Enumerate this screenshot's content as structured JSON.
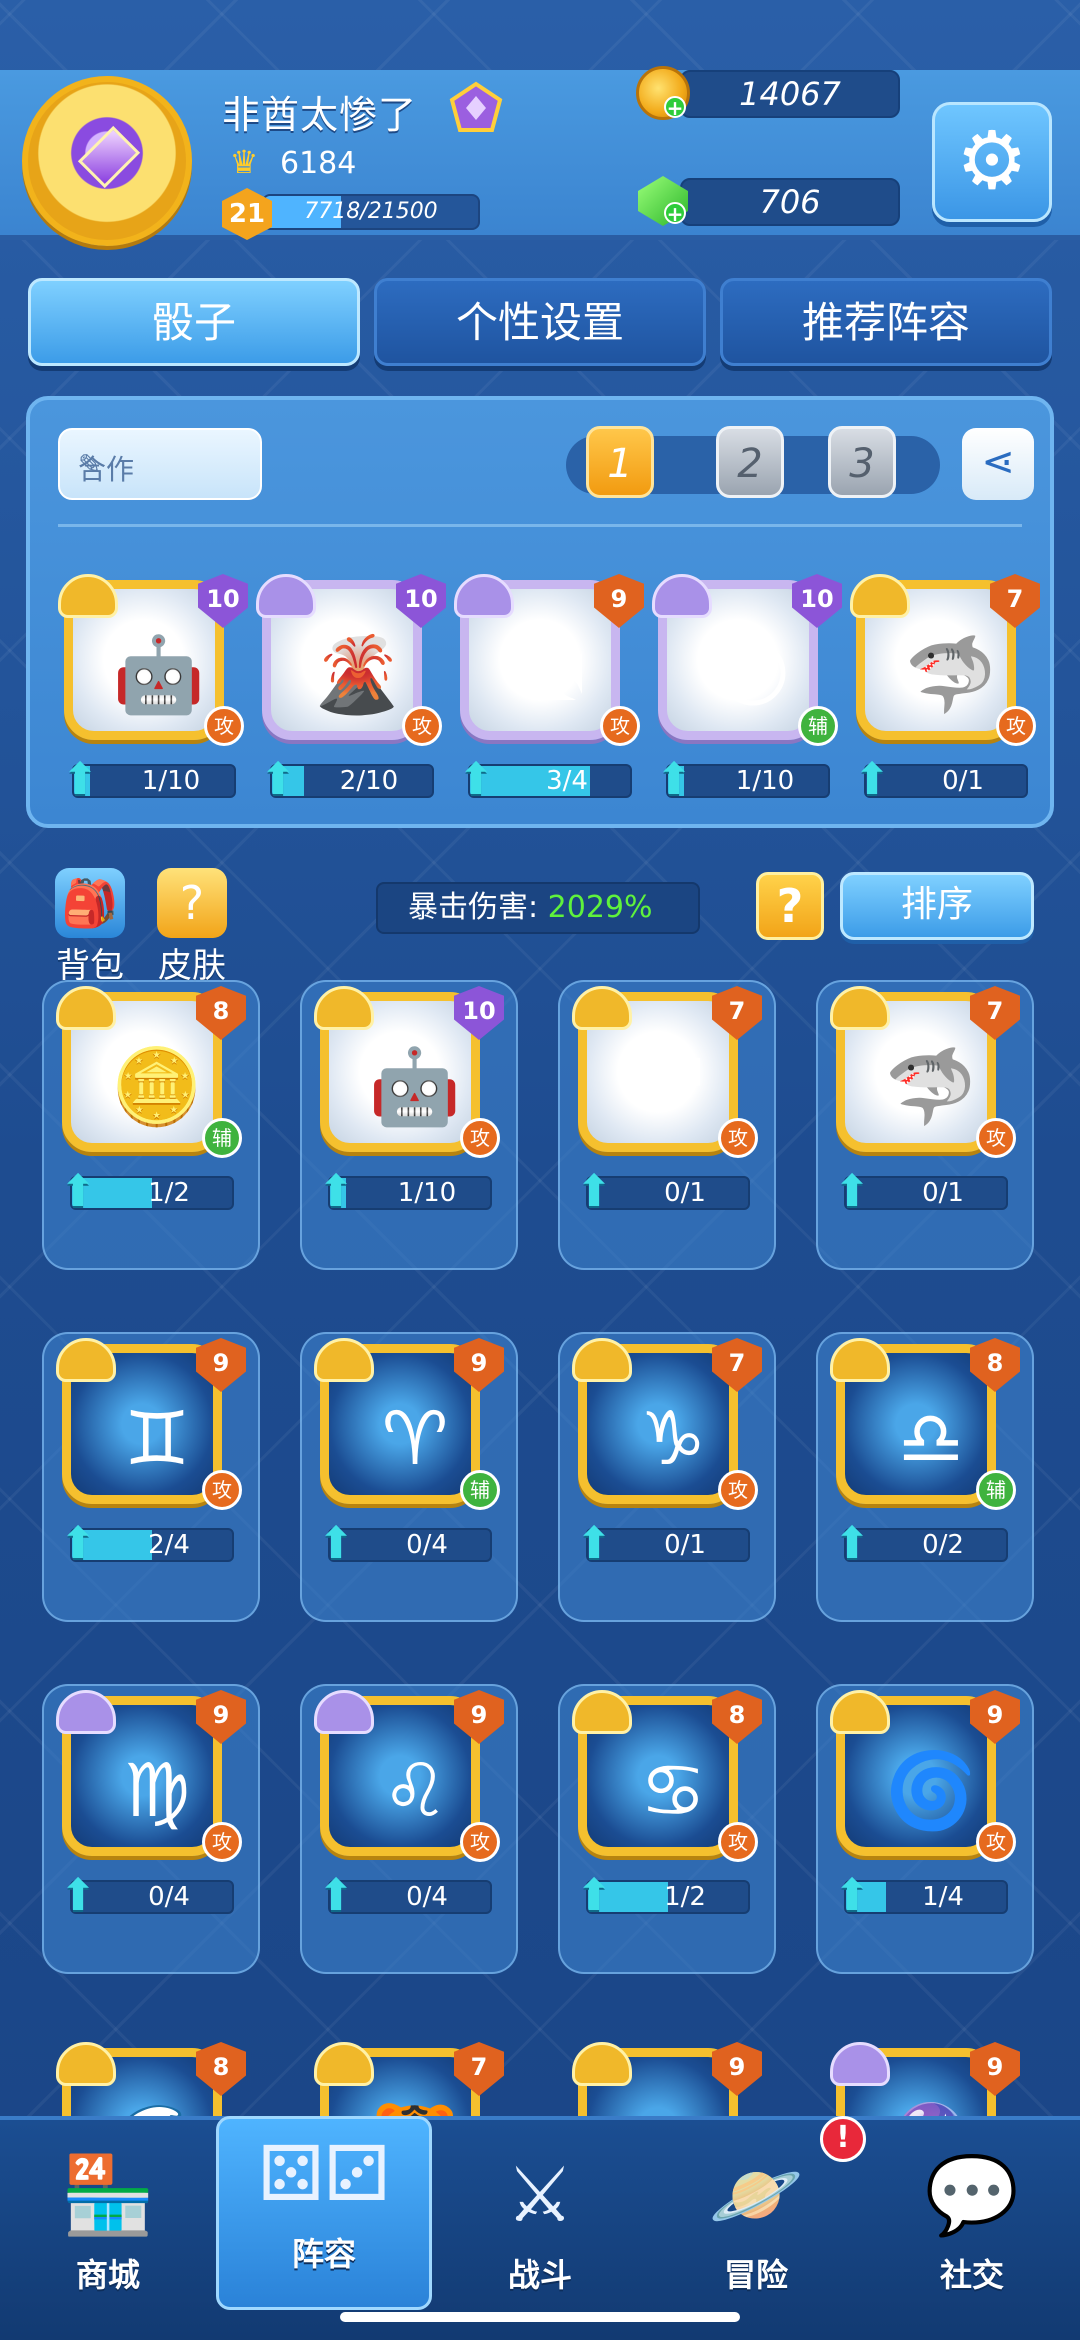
{
  "player": {
    "name": "非酋太惨了",
    "trophies": "6184",
    "level": "21",
    "xp_text": "7718/21500",
    "xp_fraction": 0.359
  },
  "currency": {
    "coins": "14067",
    "gems": "706"
  },
  "tabs": [
    {
      "label": "骰子",
      "active": true
    },
    {
      "label": "个性设置",
      "active": false
    },
    {
      "label": "推荐阵容",
      "active": false
    }
  ],
  "deck": {
    "name": "合作",
    "slots": [
      "1",
      "2",
      "3"
    ],
    "active_slot": 0,
    "cards": [
      {
        "level": "10",
        "type": "攻",
        "progress": "1/10",
        "fill": 0.1,
        "icon": "robot-icon",
        "frame": "gold",
        "crest": "gold",
        "badge": "purple"
      },
      {
        "level": "10",
        "type": "攻",
        "progress": "2/10",
        "fill": 0.2,
        "icon": "volcano-icon",
        "frame": "purple",
        "crest": "purple",
        "badge": "purple"
      },
      {
        "level": "9",
        "type": "攻",
        "progress": "3/4",
        "fill": 0.75,
        "icon": "cross-icon",
        "frame": "purple",
        "crest": "purple",
        "badge": "orange"
      },
      {
        "level": "10",
        "type": "辅",
        "progress": "1/10",
        "fill": 0.1,
        "icon": "moon-icon",
        "frame": "purple",
        "crest": "purple",
        "badge": "purple"
      },
      {
        "level": "7",
        "type": "攻",
        "progress": "0/1",
        "fill": 0.0,
        "icon": "shark-icon",
        "frame": "gold",
        "crest": "gold",
        "badge": "orange"
      }
    ]
  },
  "toolbar": {
    "backpack_label": "背包",
    "skin_label": "皮肤",
    "crit_label": "暴击伤害:",
    "crit_value": "2029%",
    "help_label": "?",
    "sort_label": "排序"
  },
  "collection": [
    {
      "level": "8",
      "type": "辅",
      "progress": "1/2",
      "fill": 0.5,
      "icon": "coin-icon",
      "dark": false,
      "crest": "gold",
      "badge": "orange"
    },
    {
      "level": "10",
      "type": "攻",
      "progress": "1/10",
      "fill": 0.1,
      "icon": "robot-icon",
      "dark": false,
      "crest": "gold",
      "badge": "purple"
    },
    {
      "level": "7",
      "type": "攻",
      "progress": "0/1",
      "fill": 0.0,
      "icon": "sagittarius-icon",
      "dark": false,
      "crest": "gold",
      "badge": "orange"
    },
    {
      "level": "7",
      "type": "攻",
      "progress": "0/1",
      "fill": 0.0,
      "icon": "shark-icon",
      "dark": false,
      "crest": "gold",
      "badge": "orange"
    },
    {
      "level": "9",
      "type": "攻",
      "progress": "2/4",
      "fill": 0.5,
      "icon": "gemini-icon",
      "dark": true,
      "crest": "gold",
      "badge": "orange"
    },
    {
      "level": "9",
      "type": "辅",
      "progress": "0/4",
      "fill": 0.0,
      "icon": "aries-icon",
      "dark": true,
      "crest": "gold",
      "badge": "orange"
    },
    {
      "level": "7",
      "type": "攻",
      "progress": "0/1",
      "fill": 0.0,
      "icon": "capricorn-icon",
      "dark": true,
      "crest": "gold",
      "badge": "orange"
    },
    {
      "level": "8",
      "type": "辅",
      "progress": "0/2",
      "fill": 0.0,
      "icon": "libra-icon",
      "dark": true,
      "crest": "gold",
      "badge": "orange"
    },
    {
      "level": "9",
      "type": "攻",
      "progress": "0/4",
      "fill": 0.0,
      "icon": "virgo-icon",
      "dark": true,
      "crest": "purple",
      "badge": "orange"
    },
    {
      "level": "9",
      "type": "攻",
      "progress": "0/4",
      "fill": 0.0,
      "icon": "leo-icon",
      "dark": true,
      "crest": "purple",
      "badge": "orange"
    },
    {
      "level": "8",
      "type": "攻",
      "progress": "1/2",
      "fill": 0.5,
      "icon": "cancer-icon",
      "dark": true,
      "crest": "gold",
      "badge": "orange"
    },
    {
      "level": "9",
      "type": "攻",
      "progress": "1/4",
      "fill": 0.25,
      "icon": "whirlpool-icon",
      "dark": true,
      "crest": "gold",
      "badge": "orange"
    }
  ],
  "partial_row": [
    {
      "level": "8",
      "icon": "wave-icon",
      "crest": "gold"
    },
    {
      "level": "7",
      "icon": "tiger-icon",
      "crest": "gold"
    },
    {
      "level": "9",
      "icon": "vortex-icon",
      "crest": "gold"
    },
    {
      "level": "9",
      "icon": "pink-orb-icon",
      "crest": "purple"
    }
  ],
  "nav": [
    {
      "label": "商城",
      "icon": "shop-icon",
      "active": false
    },
    {
      "label": "阵容",
      "icon": "dice-icon",
      "active": true
    },
    {
      "label": "战斗",
      "icon": "swords-icon",
      "active": false
    },
    {
      "label": "冒险",
      "icon": "planet-icon",
      "active": false
    },
    {
      "label": "社交",
      "icon": "chat-icon",
      "active": false
    }
  ],
  "alert_badge": "!",
  "colors": {
    "background": "#1f4d8f",
    "header": "#3b84d0",
    "gold_frame": "#f5c02e",
    "attack_badge": "#e66a1e",
    "support_badge": "#3fb33e",
    "crit_value": "#5ff23c",
    "progress_fill": "#35c6e8"
  }
}
